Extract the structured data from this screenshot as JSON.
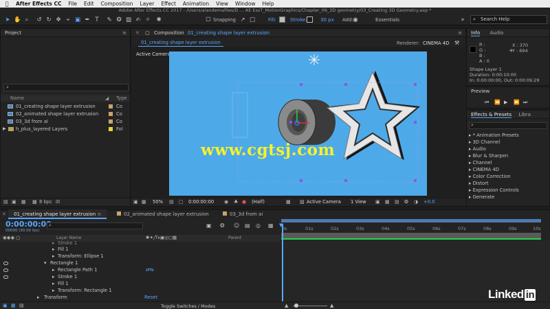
{
  "menubar": {
    "app": "After Effects CC",
    "items": [
      "File",
      "Edit",
      "Composition",
      "Layer",
      "Effect",
      "Animation",
      "View",
      "Window",
      "Help"
    ]
  },
  "document_title": "Adobe After Effects CC 2017 - /Users/alandemafiles/D ... AE EssT_MotionGraphics/Chapter_06_3D geometry/03_Creating 3D Geometry.aep *",
  "toolbar": {
    "snapping": "Snapping",
    "fill": "Fill:",
    "stroke": "Stroke:",
    "stroke_width": "30 px",
    "add": "Add:",
    "workspace": "Essentials",
    "search_placeholder": "Search Help"
  },
  "project": {
    "title": "Project",
    "col_name": "Name",
    "col_type": "Type",
    "items": [
      {
        "name": "01_creating shape layer extrusion",
        "type": "Co",
        "label_color": "#c9a46a",
        "kind": "comp"
      },
      {
        "name": "02_animated shape layer extrusion",
        "type": "Co",
        "label_color": "#c9a46a",
        "kind": "comp"
      },
      {
        "name": "03_3d from ai",
        "type": "Co",
        "label_color": "#c9a46a",
        "kind": "comp"
      },
      {
        "name": "h_plus_layered Layers",
        "type": "Fol",
        "label_color": "#e8d24a",
        "kind": "folder"
      }
    ],
    "bpc": "8 bpc"
  },
  "composition": {
    "panel_title": "Composition",
    "comp_name": "01_creating shape layer extrusion",
    "tab_label": "01_creating shape layer extrusion",
    "renderer_label": "Renderer:",
    "renderer": "CINEMA 4D",
    "camera_label": "Active Camera",
    "watermark": "www.cgtsj.com",
    "bg_color": "#4ea9e8"
  },
  "viewer_bar": {
    "zoom": "50%",
    "timecode": "0:00:00:00",
    "resolution": "(Half)",
    "camera": "Active Camera",
    "view": "1 View",
    "exposure": "+0.0"
  },
  "info": {
    "tab_info": "Info",
    "tab_audio": "Audio",
    "r": "R :",
    "g": "G :",
    "b": "B :",
    "a": "A : 0",
    "x": "X : 370",
    "y": "Y : 694",
    "layer": "Shape Layer 1",
    "duration": "Duration: 0:00:10:00",
    "in_out": "In: 0:00:00:00, Out: 0:00:09:29"
  },
  "preview": {
    "title": "Preview"
  },
  "effects": {
    "tab": "Effects & Presets",
    "tab2": "Libra",
    "items": [
      "* Animation Presets",
      "3D Channel",
      "Audio",
      "Blur & Sharpen",
      "Channel",
      "CINEMA 4D",
      "Color Correction",
      "Distort",
      "Expression Controls",
      "Generate"
    ]
  },
  "timeline": {
    "tabs": [
      "01_creating shape layer extrusion",
      "02_animated shape layer extrusion",
      "03_3d from ai"
    ],
    "timecode": "0:00:00:00",
    "frames": "00000 (30.00 fps)",
    "col_layer": "Layer Name",
    "col_parent": "Parent",
    "ticks": [
      "0s",
      "01s",
      "02s",
      "03s",
      "04s",
      "05s",
      "06s",
      "07s",
      "08s",
      "09s",
      "10s"
    ],
    "rows": [
      {
        "indent": 3,
        "text": "Stroke 1"
      },
      {
        "indent": 3,
        "text": "Fill 1"
      },
      {
        "indent": 3,
        "text": "Transform: Ellipse 1"
      },
      {
        "indent": 2,
        "text": "Rectangle 1",
        "open": true
      },
      {
        "indent": 3,
        "text": "Rectangle Path 1"
      },
      {
        "indent": 3,
        "text": "Stroke 1"
      },
      {
        "indent": 3,
        "text": "Fill 1"
      },
      {
        "indent": 3,
        "text": "Transform: Rectangle 1"
      },
      {
        "indent": 1,
        "text": "Transform"
      }
    ],
    "reset": "Reset",
    "toggle": "Toggle Switches / Modes"
  },
  "brand": {
    "linked": "Linked",
    "in": "in"
  }
}
